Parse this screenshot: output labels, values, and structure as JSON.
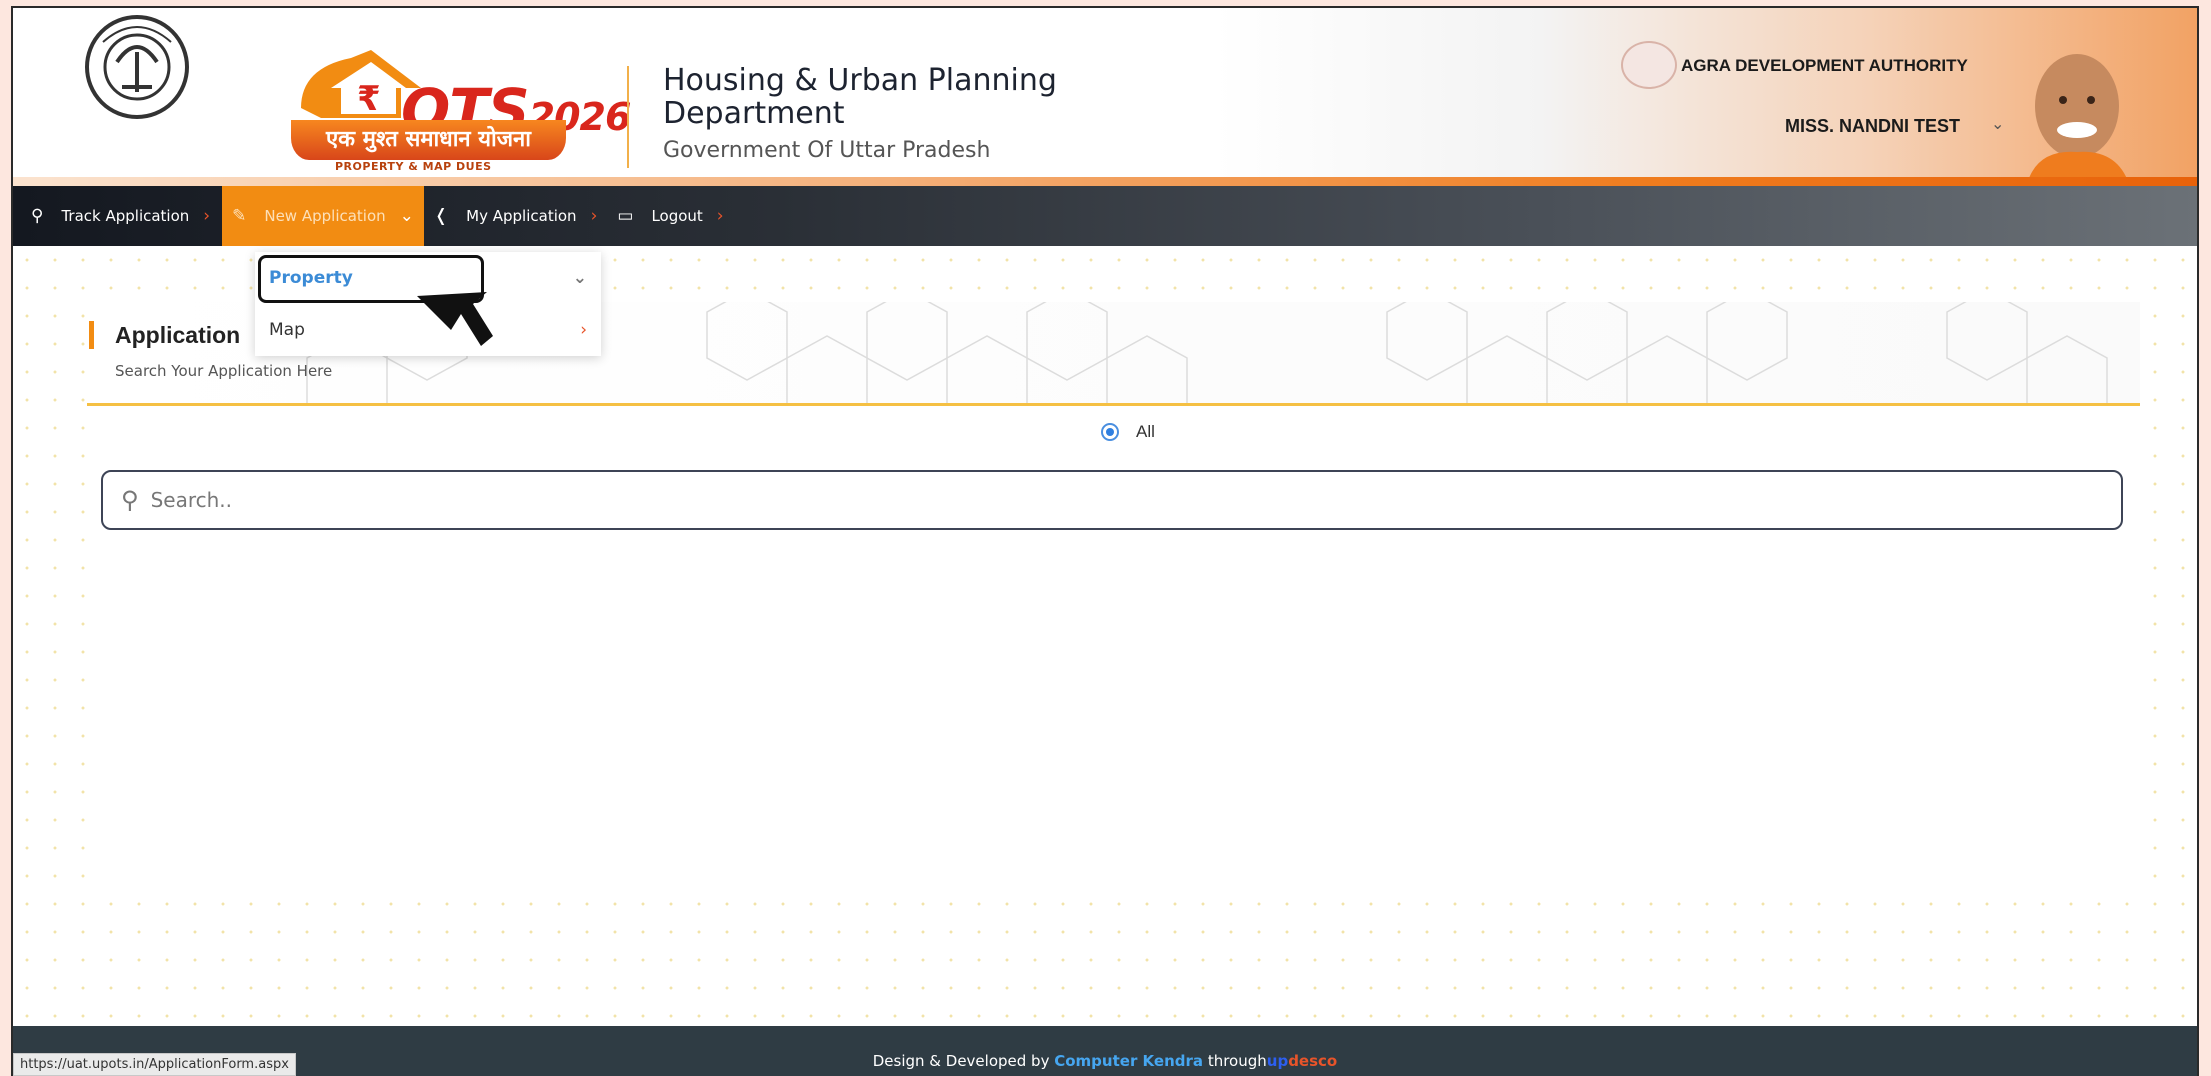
{
  "header": {
    "logo_main": "OTS",
    "logo_year": "2026",
    "logo_tagline": "एक मुश्त समाधान योजना",
    "logo_subtag": "PROPERTY & MAP DUES",
    "dept_title": "Housing & Urban Planning Department",
    "dept_sub": "Government Of Uttar Pradesh",
    "authority": "AGRA DEVELOPMENT AUTHORITY",
    "username": "MISS. NANDNI TEST"
  },
  "nav": {
    "items": [
      {
        "label": "Track Application",
        "icon": "search-icon"
      },
      {
        "label": "New Application",
        "icon": "edit-icon"
      },
      {
        "label": "My Application",
        "icon": "megaphone-icon"
      },
      {
        "label": "Logout",
        "icon": "logout-icon"
      }
    ]
  },
  "dropdown": {
    "items": [
      {
        "label": "Property"
      },
      {
        "label": "Map"
      }
    ]
  },
  "card": {
    "title": "Application",
    "subtitle": "Search Your Application Here",
    "radio_label": "All",
    "search_placeholder": "Search.."
  },
  "footer": {
    "prefix": "Design & Developed by",
    "developer": "Computer Kendra",
    "through": "through",
    "partner_a": "up",
    "partner_b": "desco"
  },
  "status_url": "https://uat.upots.in/ApplicationForm.aspx",
  "colors": {
    "accent_orange": "#f28c12",
    "nav_dark": "#1c2027",
    "footer_bg": "#2f3c44",
    "link_blue": "#3b8bd6"
  }
}
